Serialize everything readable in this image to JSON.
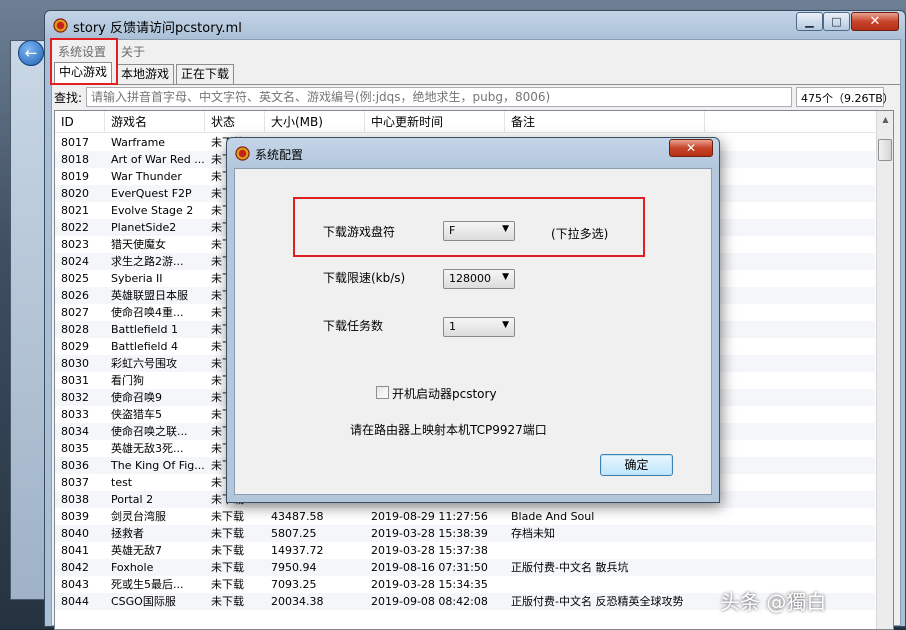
{
  "window": {
    "title": "story 反馈请访问pcstory.ml",
    "minimize_glyph": "▁",
    "maximize_glyph": "□",
    "close_glyph": "✕"
  },
  "menu": {
    "settings": "系统设置",
    "about": "关于"
  },
  "tabs": {
    "center": "中心游戏",
    "local": "本地游戏",
    "downloading": "正在下载"
  },
  "search": {
    "label": "查找:",
    "placeholder": "请输入拼音首字母、中文字符、英文名、游戏编号(例:jdqs，绝地求生，pubg，8006)",
    "count": "475个（9.26TB）"
  },
  "list": {
    "headers": {
      "id": "ID",
      "name": "游戏名",
      "status": "状态",
      "size": "大小(MB)",
      "time": "中心更新时间",
      "note": "备注"
    },
    "rows": [
      {
        "id": "8017",
        "name": "Warframe",
        "status": "未下载",
        "size": "",
        "time": "",
        "note": ""
      },
      {
        "id": "8018",
        "name": "Art of War Red ...",
        "status": "未下载",
        "size": "",
        "time": "",
        "note": ""
      },
      {
        "id": "8019",
        "name": "War Thunder",
        "status": "未下载",
        "size": "",
        "time": "",
        "note": ""
      },
      {
        "id": "8020",
        "name": "EverQuest F2P",
        "status": "未下载",
        "size": "",
        "time": "",
        "note": ""
      },
      {
        "id": "8021",
        "name": "Evolve Stage 2",
        "status": "未下载",
        "size": "",
        "time": "",
        "note": ""
      },
      {
        "id": "8022",
        "name": "PlanetSide2",
        "status": "未下载",
        "size": "",
        "time": "",
        "note": ""
      },
      {
        "id": "8023",
        "name": "猎天使魔女",
        "status": "未下载",
        "size": "",
        "time": "",
        "note": ""
      },
      {
        "id": "8024",
        "name": "求生之路2游...",
        "status": "未下载",
        "size": "",
        "time": "",
        "note": ""
      },
      {
        "id": "8025",
        "name": "Syberia II",
        "status": "未下载",
        "size": "",
        "time": "",
        "note": ""
      },
      {
        "id": "8026",
        "name": "英雄联盟日本服",
        "status": "未下载",
        "size": "",
        "time": "",
        "note": ""
      },
      {
        "id": "8027",
        "name": "使命召唤4重...",
        "status": "未下载",
        "size": "",
        "time": "",
        "note": ""
      },
      {
        "id": "8028",
        "name": "Battlefield 1",
        "status": "未下载",
        "size": "",
        "time": "",
        "note": ""
      },
      {
        "id": "8029",
        "name": "Battlefield 4",
        "status": "未下载",
        "size": "",
        "time": "",
        "note": ""
      },
      {
        "id": "8030",
        "name": "彩虹六号围攻",
        "status": "未下载",
        "size": "",
        "time": "",
        "note": ""
      },
      {
        "id": "8031",
        "name": "看门狗",
        "status": "未下载",
        "size": "",
        "time": "",
        "note": ""
      },
      {
        "id": "8032",
        "name": "使命召唤9",
        "status": "未下载",
        "size": "",
        "time": "",
        "note": ""
      },
      {
        "id": "8033",
        "name": "侠盗猎车5",
        "status": "未下载",
        "size": "",
        "time": "",
        "note": ""
      },
      {
        "id": "8034",
        "name": "使命召唤之联...",
        "status": "未下载",
        "size": "",
        "time": "",
        "note": ""
      },
      {
        "id": "8035",
        "name": "英雄无敌3死...",
        "status": "未下载",
        "size": "",
        "time": "",
        "note": ""
      },
      {
        "id": "8036",
        "name": "The King Of Fig...",
        "status": "未下载",
        "size": "",
        "time": "",
        "note": ""
      },
      {
        "id": "8037",
        "name": "test",
        "status": "未下载",
        "size": "",
        "time": "",
        "note": ""
      },
      {
        "id": "8038",
        "name": "Portal 2",
        "status": "未下载",
        "size": "",
        "time": "",
        "note": ""
      },
      {
        "id": "8039",
        "name": "剑灵台湾服",
        "status": "未下载",
        "size": "43487.58",
        "time": "2019-08-29 11:27:56",
        "note": "Blade And Soul"
      },
      {
        "id": "8040",
        "name": "拯救者",
        "status": "未下载",
        "size": "5807.25",
        "time": "2019-03-28 15:38:39",
        "note": "存档未知"
      },
      {
        "id": "8041",
        "name": "英雄无敌7",
        "status": "未下载",
        "size": "14937.72",
        "time": "2019-03-28 15:37:38",
        "note": ""
      },
      {
        "id": "8042",
        "name": "Foxhole",
        "status": "未下载",
        "size": "7950.94",
        "time": "2019-08-16 07:31:50",
        "note": "正版付费-中文名 散兵坑"
      },
      {
        "id": "8043",
        "name": "死或生5最后...",
        "status": "未下载",
        "size": "7093.25",
        "time": "2019-03-28 15:34:35",
        "note": ""
      },
      {
        "id": "8044",
        "name": "CSGO国际服",
        "status": "未下载",
        "size": "20034.38",
        "time": "2019-09-08 08:42:08",
        "note": "正版付费-中文名 反恐精英全球攻势"
      }
    ]
  },
  "dialog": {
    "title": "系统配置",
    "close_glyph": "✕",
    "drive_label": "下载游戏盘符",
    "drive_value": "F",
    "drive_hint": "(下拉多选)",
    "speed_label": "下载限速(kb/s)",
    "speed_value": "128000",
    "tasks_label": "下载任务数",
    "tasks_value": "1",
    "autostart_label": "开机启动器pcstory",
    "router_note": "请在路由器上映射本机TCP9927端口",
    "ok_label": "确定"
  },
  "watermark": "头条 @獨白",
  "colors": {
    "highlight_red": "#e02020",
    "title_bar": "#b3c7dc"
  }
}
